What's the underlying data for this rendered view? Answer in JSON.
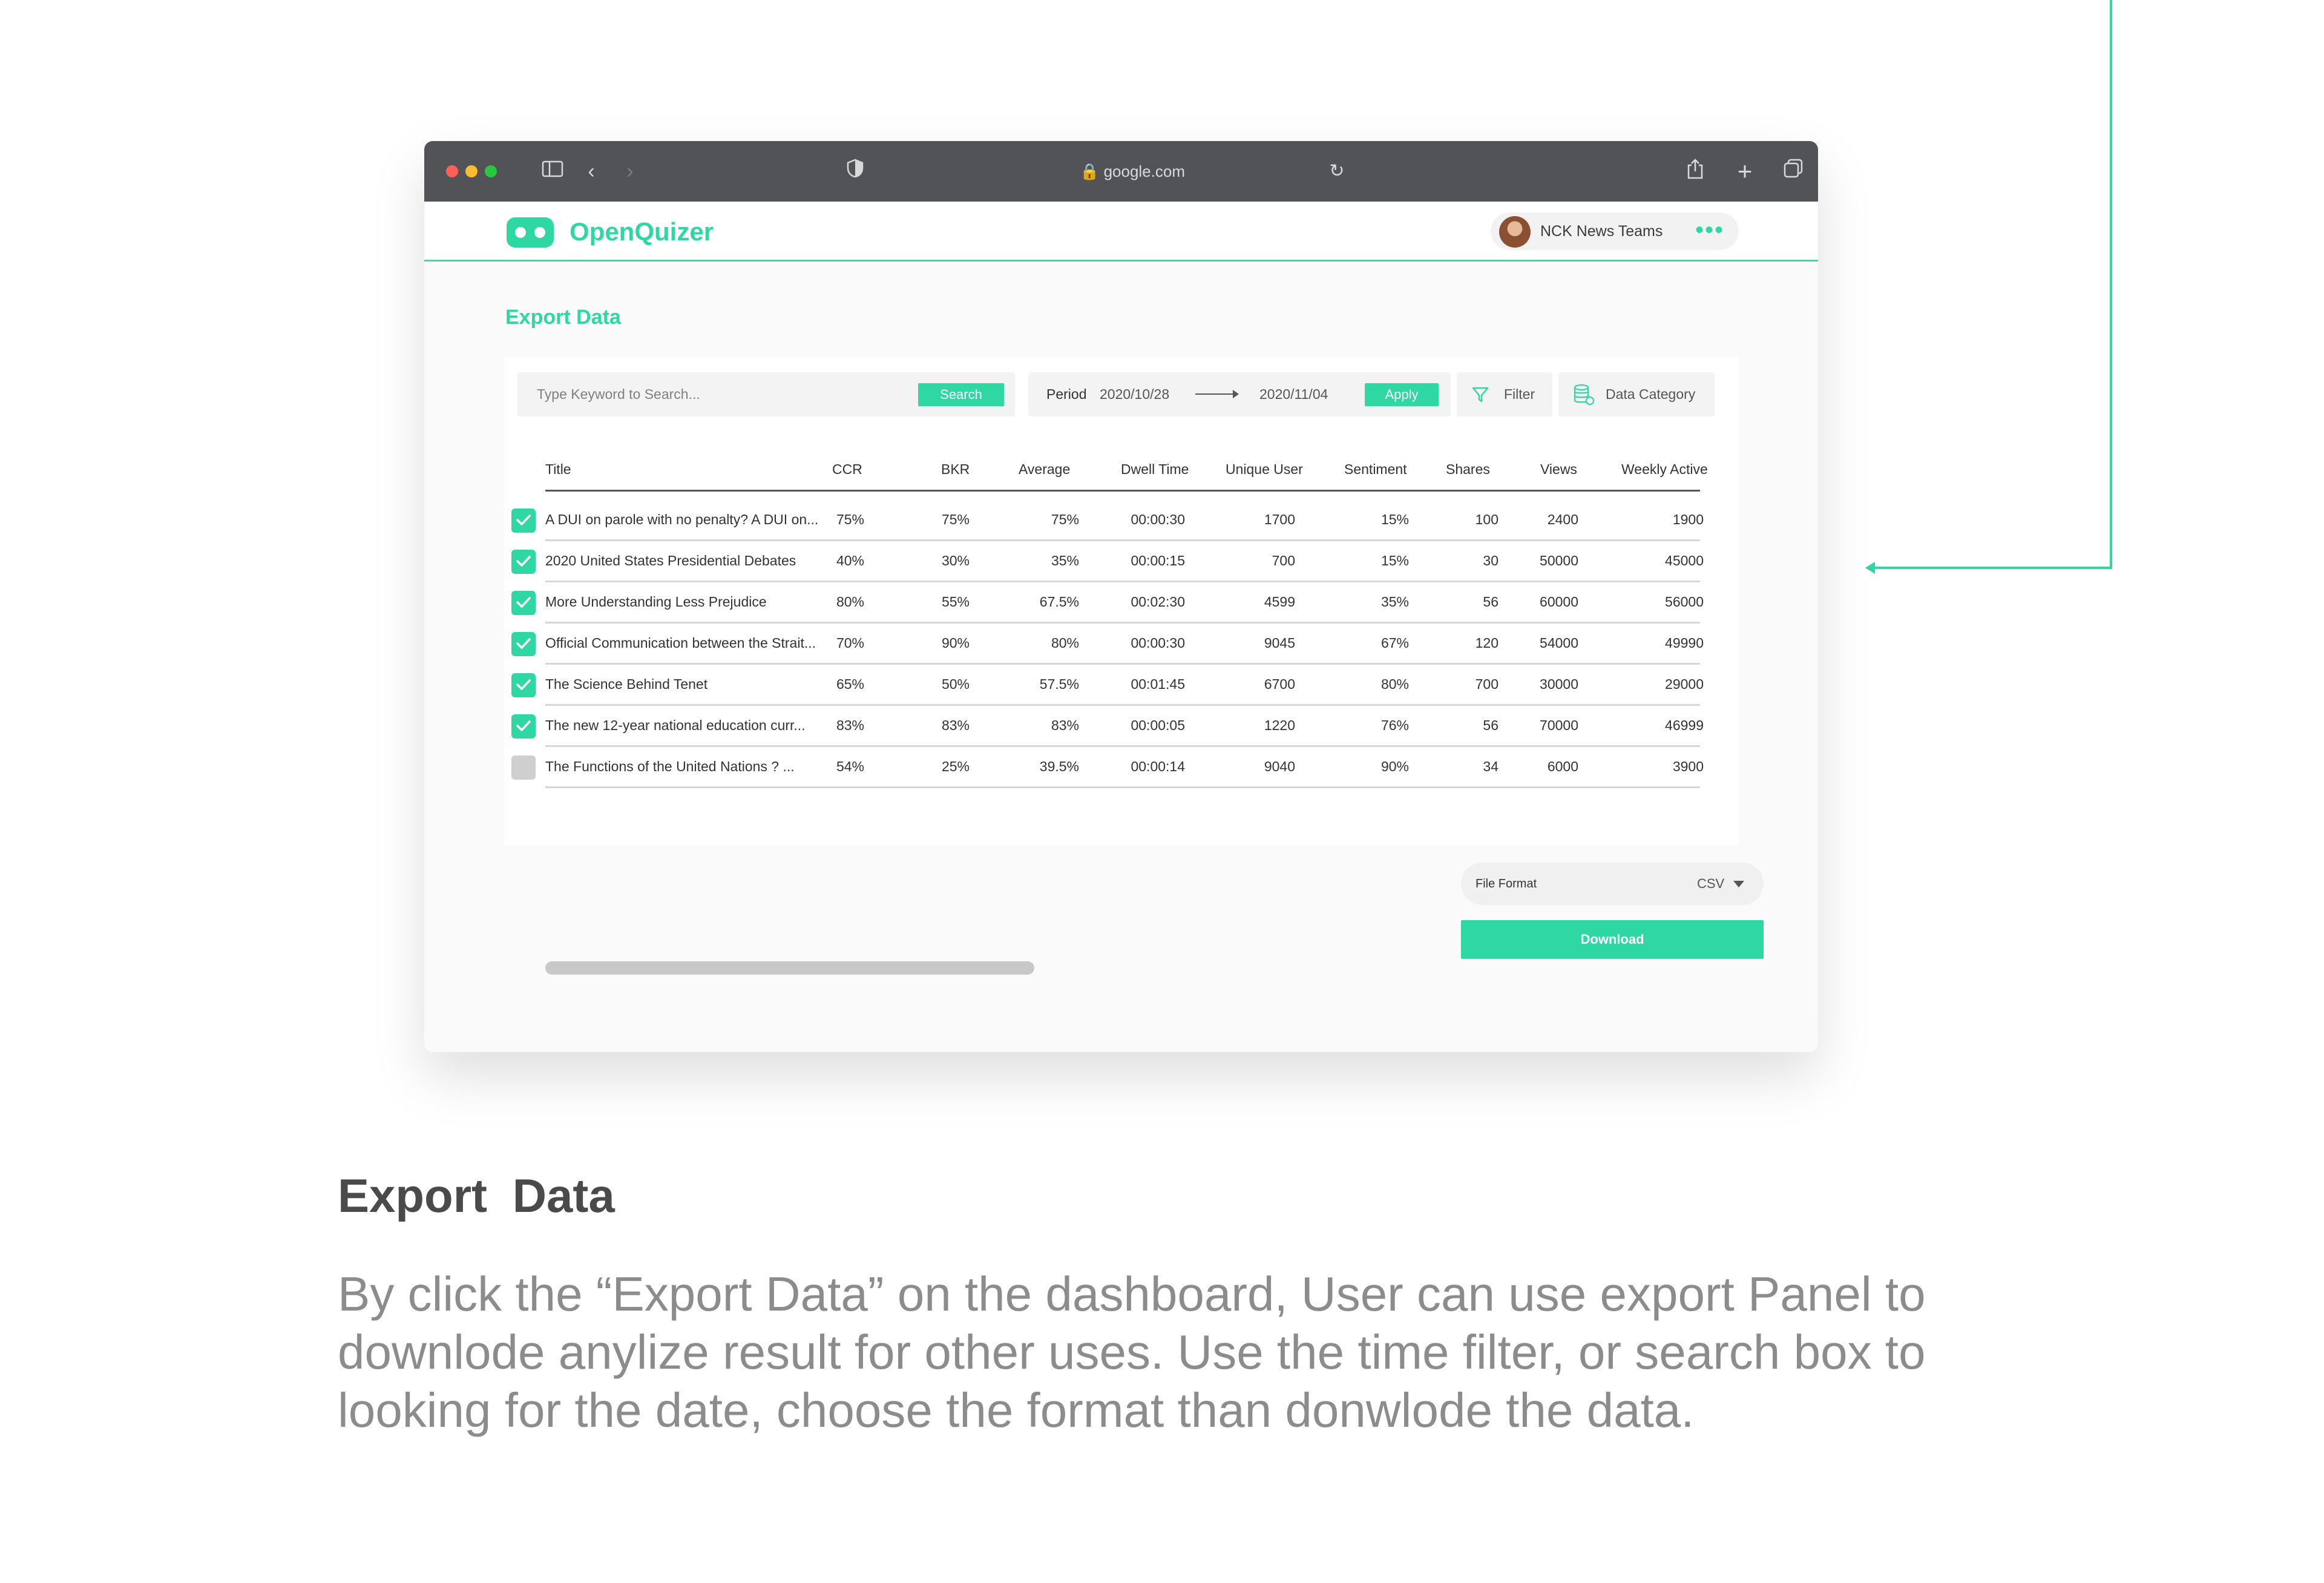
{
  "browser": {
    "url": "google.com"
  },
  "app": {
    "name": "OpenQuizer",
    "user": "NCK News Teams",
    "more_icon": "ellipsis-icon"
  },
  "page": {
    "title": "Export Data"
  },
  "search": {
    "placeholder": "Type Keyword to Search...",
    "button": "Search"
  },
  "period": {
    "label": "Period",
    "start": "2020/10/28",
    "end": "2020/11/04",
    "apply": "Apply"
  },
  "filter": {
    "label": "Filter"
  },
  "category": {
    "label": "Data Category"
  },
  "table": {
    "columns": [
      "Title",
      "CCR",
      "BKR",
      "Average",
      "Dwell Time",
      "Unique User",
      "Sentiment",
      "Shares",
      "Views",
      "Weekly Active"
    ],
    "rows": [
      {
        "checked": true,
        "cells": [
          "A DUI on parole with no penalty? A DUI on...",
          "75%",
          "75%",
          "75%",
          "00:00:30",
          "1700",
          "15%",
          "100",
          "2400",
          "1900"
        ]
      },
      {
        "checked": true,
        "cells": [
          "2020 United States Presidential Debates",
          "40%",
          "30%",
          "35%",
          "00:00:15",
          "700",
          "15%",
          "30",
          "50000",
          "45000"
        ]
      },
      {
        "checked": true,
        "cells": [
          "More Understanding Less Prejudice",
          "80%",
          "55%",
          "67.5%",
          "00:02:30",
          "4599",
          "35%",
          "56",
          "60000",
          "56000"
        ]
      },
      {
        "checked": true,
        "cells": [
          "Official Communication between the Strait...",
          "70%",
          "90%",
          "80%",
          "00:00:30",
          "9045",
          "67%",
          "120",
          "54000",
          "49990"
        ]
      },
      {
        "checked": true,
        "cells": [
          "The Science Behind Tenet",
          "65%",
          "50%",
          "57.5%",
          "00:01:45",
          "6700",
          "80%",
          "700",
          "30000",
          "29000"
        ]
      },
      {
        "checked": true,
        "cells": [
          "The new 12-year national education curr...",
          "83%",
          "83%",
          "83%",
          "00:00:05",
          "1220",
          "76%",
          "56",
          "70000",
          "46999"
        ]
      },
      {
        "checked": false,
        "cells": [
          "The Functions of the United Nations ? ...",
          "54%",
          "25%",
          "39.5%",
          "00:00:14",
          "9040",
          "90%",
          "34",
          "6000",
          "3900"
        ]
      }
    ]
  },
  "export": {
    "format_label": "File Format",
    "format_value": "CSV",
    "download": "Download"
  },
  "caption": {
    "title": "Export Data",
    "body": "By click the “Export Data” on the dashboard, User can use export Panel to downlode anylize result for other uses. Use the time filter,  or search box to looking for the date, choose the format than donwlode the data."
  },
  "colors": {
    "accent": "#2fd8a3",
    "chrome": "#525357"
  }
}
